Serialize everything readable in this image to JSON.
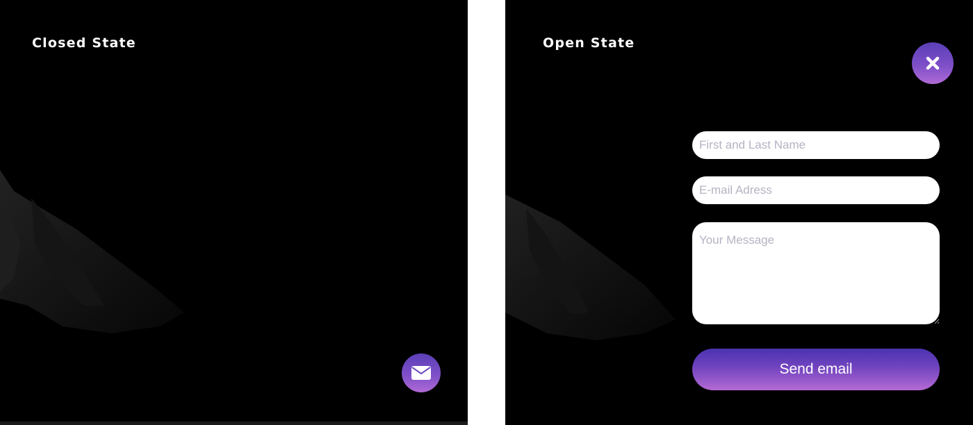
{
  "closed_panel": {
    "title": "Closed State",
    "fab_icon": "envelope-icon"
  },
  "open_panel": {
    "title": "Open State",
    "close_icon": "close-icon",
    "form": {
      "name_placeholder": "First and Last Name",
      "email_placeholder": "E-mail Adress",
      "message_placeholder": "Your Message",
      "send_label": "Send email"
    }
  },
  "colors": {
    "accent_top": "#4a33b0",
    "accent_bottom": "#b46ad3",
    "background": "#000000"
  }
}
